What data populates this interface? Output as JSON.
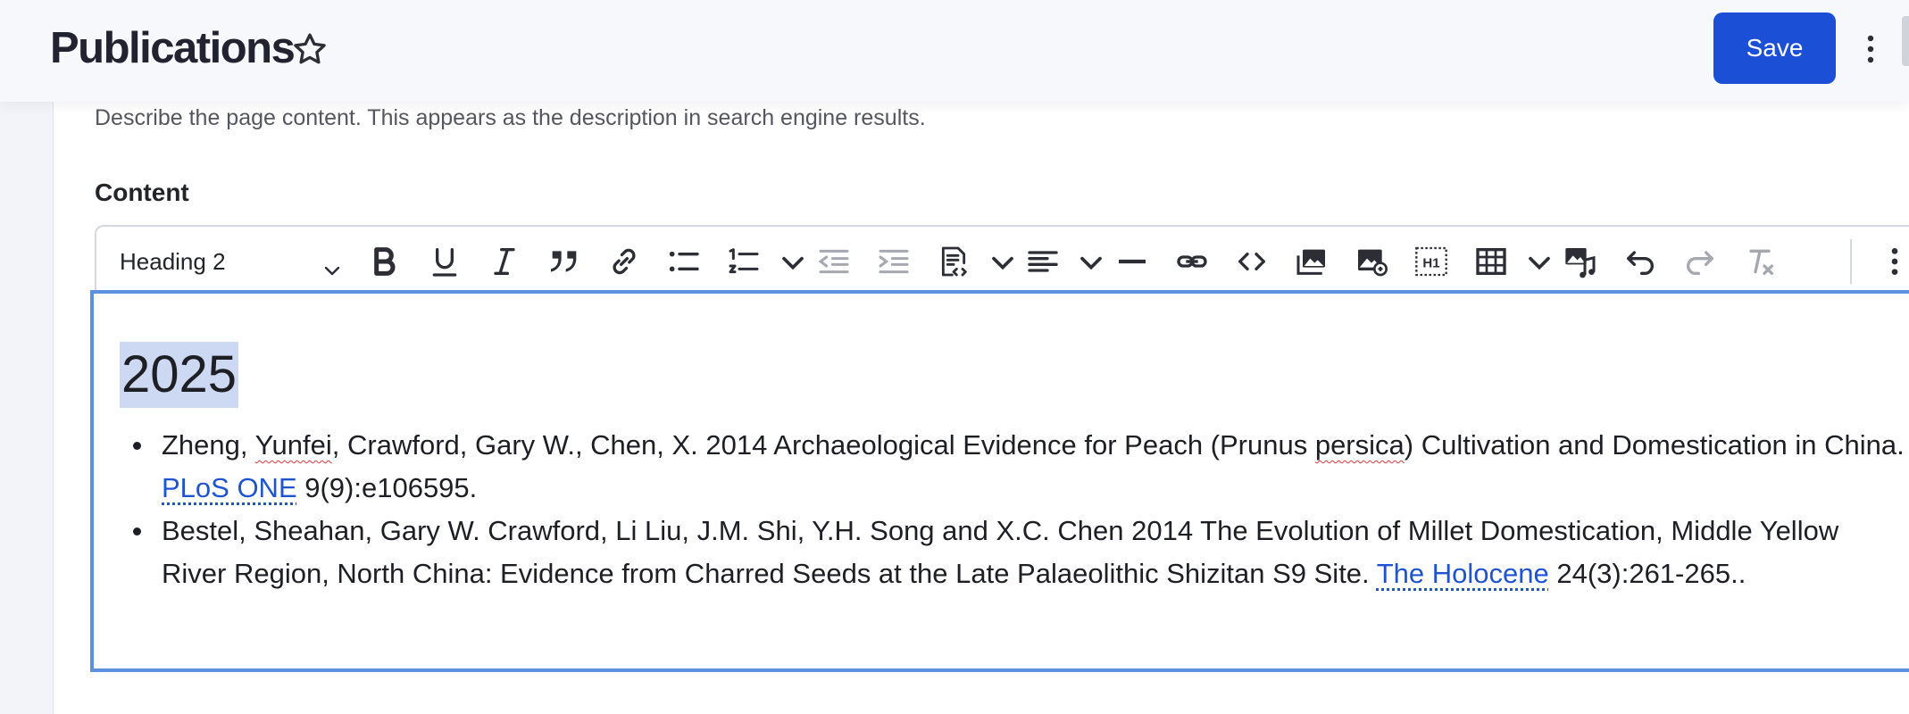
{
  "header": {
    "title": "Publications",
    "save_label": "Save",
    "accent_color": "#1b4fd6"
  },
  "form": {
    "description_help": "Describe the page content. This appears as the description in search engine results.",
    "content_label": "Content"
  },
  "toolbar": {
    "format_select_value": "Heading 2",
    "icons": [
      "bold-icon",
      "underline-icon",
      "italic-icon",
      "blockquote-icon",
      "link-icon",
      "bulleted-list-icon",
      "numbered-list-icon",
      "numbered-list-dropdown-icon",
      "outdent-icon",
      "indent-icon",
      "source-editing-icon",
      "source-dropdown-icon",
      "align-icon",
      "align-dropdown-icon",
      "horizontal-line-icon",
      "drupal-link-icon",
      "code-icon",
      "media-library-icon",
      "insert-image-icon",
      "heading-one-icon",
      "table-icon",
      "table-dropdown-icon",
      "audio-media-icon",
      "undo-icon",
      "redo-icon",
      "remove-format-icon",
      "more-options-icon"
    ]
  },
  "editor": {
    "heading": "2025",
    "items": [
      {
        "part1": "Zheng, ",
        "misspelled1": "Yunfei",
        "part2": ", Crawford, Gary W., Chen, X.  2014  Archaeological Evidence for Peach (Prunus ",
        "misspelled2": "persica",
        "part3": ") Cultivation and Domestication in China. ",
        "link": "PLoS ONE",
        "part4": " 9(9):e106595."
      },
      {
        "part1": "Bestel, Sheahan, Gary W. Crawford, Li Liu, J.M. Shi, Y.H. Song and X.C. Chen  2014  The Evolution of Millet Domestication, Middle Yellow River Region, North China: Evidence from Charred Seeds at the Late Palaeolithic Shizitan S9 Site. ",
        "link": "The Holocene",
        "part4": " 24(3):261-265.."
      }
    ]
  }
}
